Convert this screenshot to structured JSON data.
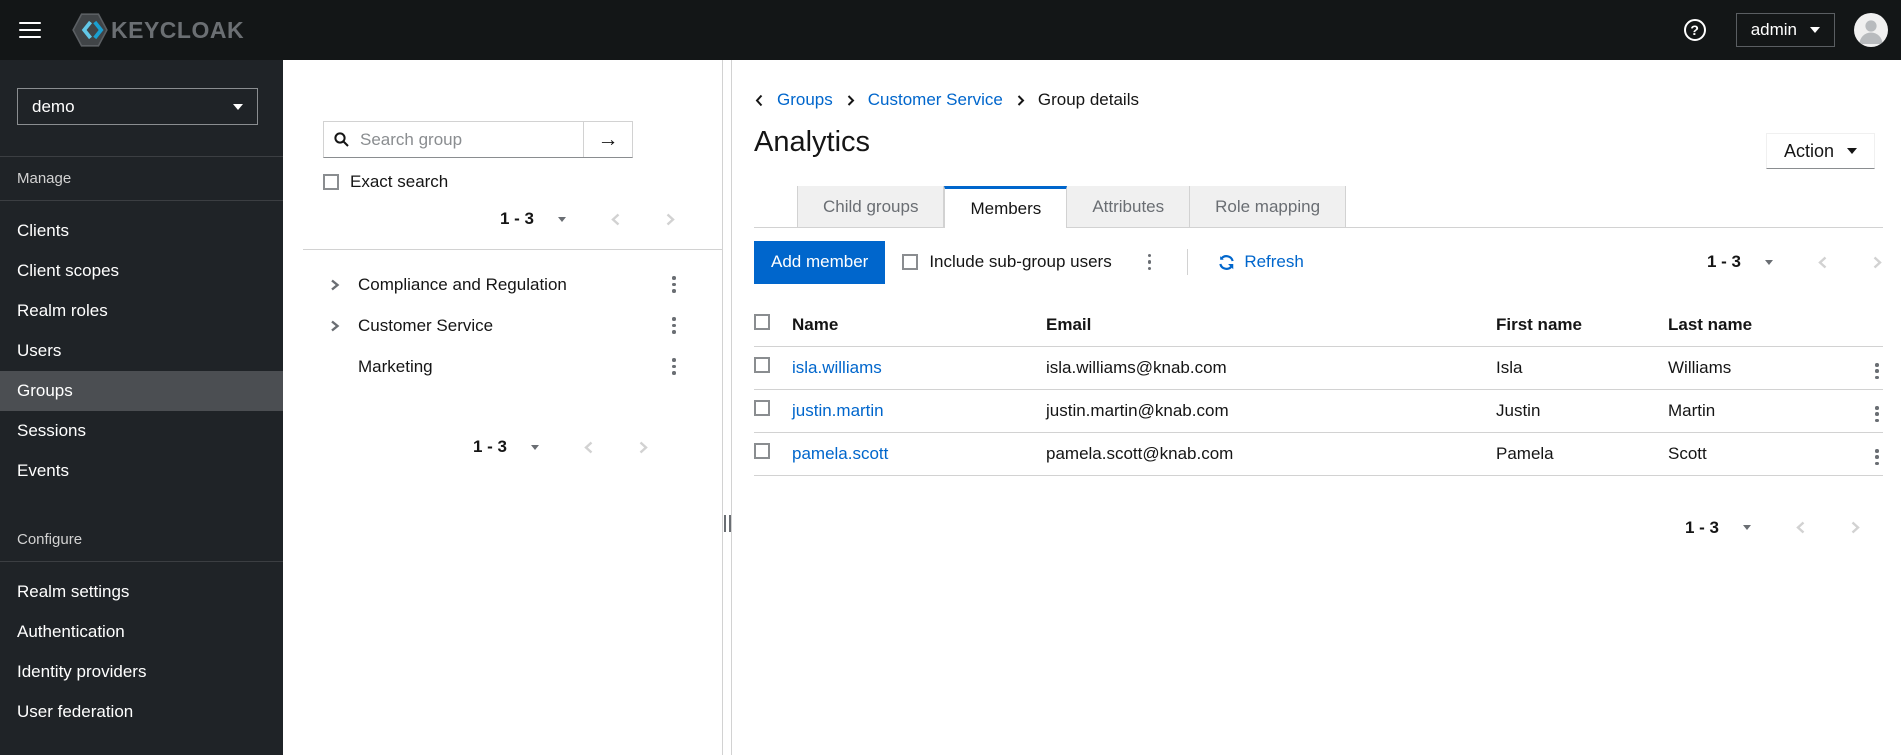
{
  "colors": {
    "primary": "#0066cc",
    "masthead_bg": "#131617",
    "sidebar_bg": "#1f2327",
    "sidebar_selected_bg": "#4b4e52",
    "brand_cyan_light": "#62c8e8",
    "brand_cyan_dark": "#1a9fd0",
    "tab_inactive_bg": "#f0f0f0",
    "border": "#d2d2d2"
  },
  "topbar": {
    "brand": "KEYCLOAK",
    "username": "admin"
  },
  "sidebar": {
    "realm": "demo",
    "sections": [
      {
        "label": "Manage",
        "items": [
          {
            "label": "Clients"
          },
          {
            "label": "Client scopes"
          },
          {
            "label": "Realm roles"
          },
          {
            "label": "Users"
          },
          {
            "label": "Groups",
            "selected": true
          },
          {
            "label": "Sessions"
          },
          {
            "label": "Events"
          }
        ]
      },
      {
        "label": "Configure",
        "items": [
          {
            "label": "Realm settings"
          },
          {
            "label": "Authentication"
          },
          {
            "label": "Identity providers"
          },
          {
            "label": "User federation"
          }
        ]
      }
    ]
  },
  "tree_panel": {
    "search_placeholder": "Search group",
    "exact_search": "Exact search",
    "top_pagination": "1 - 3",
    "groups": [
      {
        "name": "Compliance and Regulation",
        "expandable": true
      },
      {
        "name": "Customer Service",
        "expandable": true
      },
      {
        "name": "Marketing",
        "expandable": false
      }
    ],
    "bottom_pagination": "1 - 3"
  },
  "main": {
    "breadcrumb": {
      "items": [
        "Groups",
        "Customer Service",
        "Group details"
      ]
    },
    "title": "Analytics",
    "action": "Action",
    "tabs": [
      {
        "label": "Child groups"
      },
      {
        "label": "Members",
        "active": true
      },
      {
        "label": "Attributes"
      },
      {
        "label": "Role mapping"
      }
    ],
    "toolbar": {
      "add_member": "Add member",
      "include_subgroups": "Include sub-group users",
      "refresh": "Refresh",
      "pagination": "1 - 3"
    },
    "table": {
      "headers": [
        "Name",
        "Email",
        "First name",
        "Last name"
      ],
      "rows": [
        {
          "name": "isla.williams",
          "email": "isla.williams@knab.com",
          "first_name": "Isla",
          "last_name": "Williams"
        },
        {
          "name": "justin.martin",
          "email": "justin.martin@knab.com",
          "first_name": "Justin",
          "last_name": "Martin"
        },
        {
          "name": "pamela.scott",
          "email": "pamela.scott@knab.com",
          "first_name": "Pamela",
          "last_name": "Scott"
        }
      ]
    },
    "bottom_pagination": "1 - 3"
  }
}
